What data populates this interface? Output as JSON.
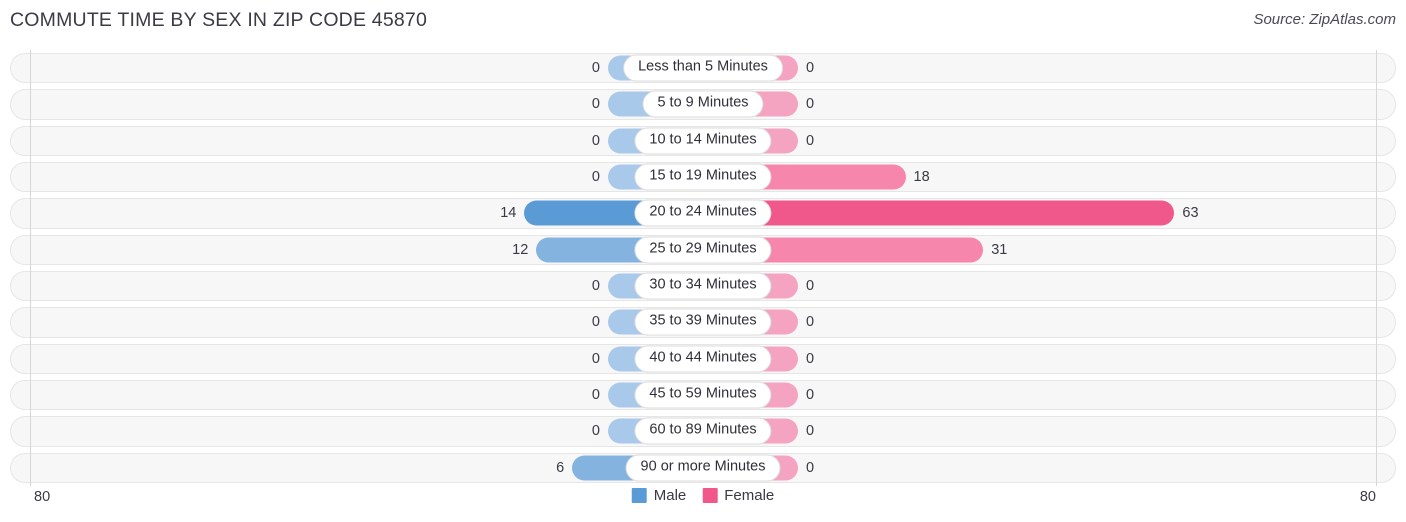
{
  "header": {
    "title": "COMMUTE TIME BY SEX IN ZIP CODE 45870",
    "source": "Source: ZipAtlas.com"
  },
  "legend": {
    "male_label": "Male",
    "female_label": "Female",
    "male_color": "#5b9bd5",
    "female_color": "#f0588c"
  },
  "axis": {
    "left_tick": "80",
    "right_tick": "80"
  },
  "chart_data": {
    "type": "bar",
    "title": "COMMUTE TIME BY SEX IN ZIP CODE 45870",
    "orientation": "horizontal-diverging",
    "xlabel": "",
    "ylabel": "",
    "xlim": [
      80,
      80
    ],
    "grid": false,
    "legend_position": "bottom-center",
    "categories": [
      "Less than 5 Minutes",
      "5 to 9 Minutes",
      "10 to 14 Minutes",
      "15 to 19 Minutes",
      "20 to 24 Minutes",
      "25 to 29 Minutes",
      "30 to 34 Minutes",
      "35 to 39 Minutes",
      "40 to 44 Minutes",
      "45 to 59 Minutes",
      "60 to 89 Minutes",
      "90 or more Minutes"
    ],
    "series": [
      {
        "name": "Male",
        "values": [
          0,
          0,
          0,
          0,
          14,
          12,
          0,
          0,
          0,
          0,
          0,
          6
        ]
      },
      {
        "name": "Female",
        "values": [
          0,
          0,
          0,
          18,
          63,
          31,
          0,
          0,
          0,
          0,
          0,
          0
        ]
      }
    ]
  },
  "rows": [
    {
      "category": "Less than 5 Minutes",
      "male": "0",
      "female": "0"
    },
    {
      "category": "5 to 9 Minutes",
      "male": "0",
      "female": "0"
    },
    {
      "category": "10 to 14 Minutes",
      "male": "0",
      "female": "0"
    },
    {
      "category": "15 to 19 Minutes",
      "male": "0",
      "female": "18"
    },
    {
      "category": "20 to 24 Minutes",
      "male": "14",
      "female": "63"
    },
    {
      "category": "25 to 29 Minutes",
      "male": "12",
      "female": "31"
    },
    {
      "category": "30 to 34 Minutes",
      "male": "0",
      "female": "0"
    },
    {
      "category": "35 to 39 Minutes",
      "male": "0",
      "female": "0"
    },
    {
      "category": "40 to 44 Minutes",
      "male": "0",
      "female": "0"
    },
    {
      "category": "45 to 59 Minutes",
      "male": "0",
      "female": "0"
    },
    {
      "category": "60 to 89 Minutes",
      "male": "0",
      "female": "0"
    },
    {
      "category": "90 or more Minutes",
      "male": "6",
      "female": "0"
    }
  ]
}
